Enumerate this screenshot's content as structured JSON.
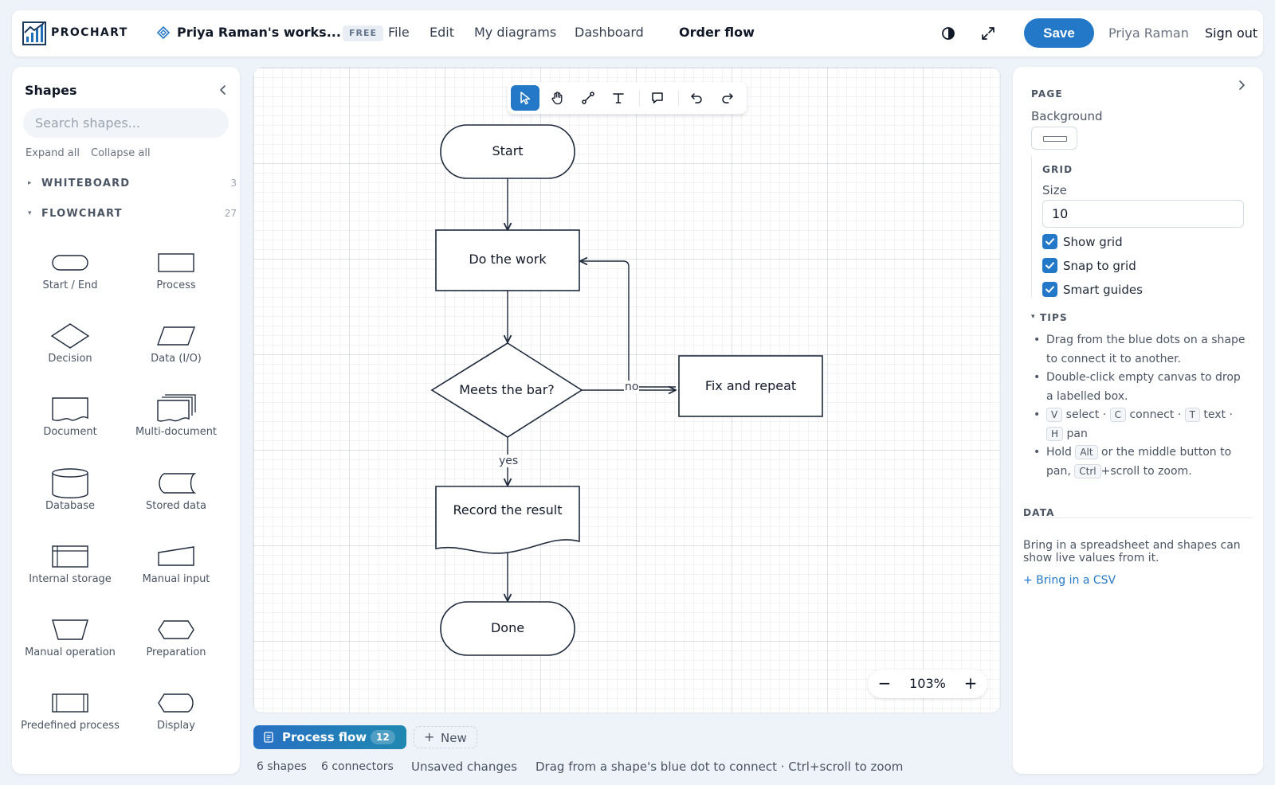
{
  "app": {
    "brand": "PROCHART",
    "workspace": "Priya Raman's works...",
    "plan_badge": "FREE"
  },
  "nav": {
    "file": "File",
    "edit": "Edit",
    "my_diagrams": "My diagrams",
    "dashboard": "Dashboard",
    "current": "Order flow"
  },
  "header": {
    "save_label": "Save",
    "user_name": "Priya Raman",
    "sign_out": "Sign out",
    "theme_icon": "contrast-icon",
    "fullscreen_icon": "expand-icon"
  },
  "colors": {
    "accent": "#2478c8",
    "tab_gradient_end": "#1f88b0",
    "canvas_stroke": "#1e293b"
  },
  "shapes_panel": {
    "title": "Shapes",
    "search_placeholder": "Search shapes...",
    "expand_all": "Expand all",
    "collapse_all": "Collapse all",
    "sections": [
      {
        "label": "WHITEBOARD",
        "count": "3",
        "expanded": false
      },
      {
        "label": "FLOWCHART",
        "count": "27",
        "expanded": true
      }
    ],
    "items": [
      "Start / End",
      "Process",
      "Decision",
      "Data (I/O)",
      "Document",
      "Multi-document",
      "Database",
      "Stored data",
      "Internal storage",
      "Manual input",
      "Manual operation",
      "Preparation",
      "Predefined process",
      "Display"
    ]
  },
  "toolbar": {
    "tools": [
      "select-tool",
      "pan-tool",
      "connector-tool",
      "text-tool",
      "comment-tool",
      "undo",
      "redo"
    ],
    "selected": "select-tool"
  },
  "diagram": {
    "nodes": {
      "start": "Start",
      "work": "Do the work",
      "decision": "Meets the bar?",
      "fix": "Fix and repeat",
      "record": "Record the result",
      "done": "Done"
    },
    "edge_labels": {
      "no": "no",
      "yes": "yes"
    }
  },
  "zoom": {
    "minus": "−",
    "value": "103%",
    "plus": "+"
  },
  "tabs": {
    "active_label": "Process flow",
    "active_count": "12",
    "new_label": "New"
  },
  "status": {
    "shapes": "6 shapes",
    "connectors": "6 connectors",
    "saved_state": "Unsaved changes",
    "hint": "Drag from a shape's blue dot to connect · Ctrl+scroll to zoom"
  },
  "properties": {
    "page_heading": "PAGE",
    "background_label": "Background",
    "grid_heading": "GRID",
    "size_label": "Size",
    "size_value": "10",
    "show_grid": "Show grid",
    "snap_to_grid": "Snap to grid",
    "smart_guides": "Smart guides",
    "tips_heading": "TIPS",
    "tips": {
      "t1": "Drag from the blue dots on a shape to connect it to another.",
      "t2": "Double-click empty canvas to drop a labelled box.",
      "t3": {
        "k1": "V",
        "w1": " select · ",
        "k2": "C",
        "w2": " connect · ",
        "k3": "T",
        "w3": " text · ",
        "k4": "H",
        "w4": " pan"
      },
      "t4": {
        "w1": "Hold ",
        "k1": "Alt",
        "w2": " or the middle button to pan, ",
        "k2": "Ctrl",
        "w3": "+scroll to zoom."
      }
    },
    "data_heading": "DATA",
    "data_desc": "Bring in a spreadsheet and shapes can show live values from it.",
    "data_link": "+ Bring in a CSV"
  }
}
